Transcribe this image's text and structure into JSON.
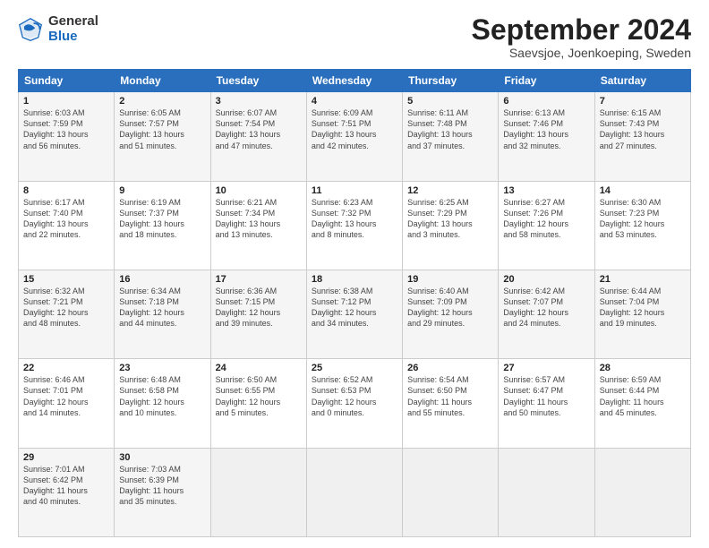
{
  "header": {
    "logo_general": "General",
    "logo_blue": "Blue",
    "month_title": "September 2024",
    "location": "Saevsjoe, Joenkoeping, Sweden"
  },
  "columns": [
    "Sunday",
    "Monday",
    "Tuesday",
    "Wednesday",
    "Thursday",
    "Friday",
    "Saturday"
  ],
  "weeks": [
    [
      {
        "day": "1",
        "info": "Sunrise: 6:03 AM\nSunset: 7:59 PM\nDaylight: 13 hours\nand 56 minutes."
      },
      {
        "day": "2",
        "info": "Sunrise: 6:05 AM\nSunset: 7:57 PM\nDaylight: 13 hours\nand 51 minutes."
      },
      {
        "day": "3",
        "info": "Sunrise: 6:07 AM\nSunset: 7:54 PM\nDaylight: 13 hours\nand 47 minutes."
      },
      {
        "day": "4",
        "info": "Sunrise: 6:09 AM\nSunset: 7:51 PM\nDaylight: 13 hours\nand 42 minutes."
      },
      {
        "day": "5",
        "info": "Sunrise: 6:11 AM\nSunset: 7:48 PM\nDaylight: 13 hours\nand 37 minutes."
      },
      {
        "day": "6",
        "info": "Sunrise: 6:13 AM\nSunset: 7:46 PM\nDaylight: 13 hours\nand 32 minutes."
      },
      {
        "day": "7",
        "info": "Sunrise: 6:15 AM\nSunset: 7:43 PM\nDaylight: 13 hours\nand 27 minutes."
      }
    ],
    [
      {
        "day": "8",
        "info": "Sunrise: 6:17 AM\nSunset: 7:40 PM\nDaylight: 13 hours\nand 22 minutes."
      },
      {
        "day": "9",
        "info": "Sunrise: 6:19 AM\nSunset: 7:37 PM\nDaylight: 13 hours\nand 18 minutes."
      },
      {
        "day": "10",
        "info": "Sunrise: 6:21 AM\nSunset: 7:34 PM\nDaylight: 13 hours\nand 13 minutes."
      },
      {
        "day": "11",
        "info": "Sunrise: 6:23 AM\nSunset: 7:32 PM\nDaylight: 13 hours\nand 8 minutes."
      },
      {
        "day": "12",
        "info": "Sunrise: 6:25 AM\nSunset: 7:29 PM\nDaylight: 13 hours\nand 3 minutes."
      },
      {
        "day": "13",
        "info": "Sunrise: 6:27 AM\nSunset: 7:26 PM\nDaylight: 12 hours\nand 58 minutes."
      },
      {
        "day": "14",
        "info": "Sunrise: 6:30 AM\nSunset: 7:23 PM\nDaylight: 12 hours\nand 53 minutes."
      }
    ],
    [
      {
        "day": "15",
        "info": "Sunrise: 6:32 AM\nSunset: 7:21 PM\nDaylight: 12 hours\nand 48 minutes."
      },
      {
        "day": "16",
        "info": "Sunrise: 6:34 AM\nSunset: 7:18 PM\nDaylight: 12 hours\nand 44 minutes."
      },
      {
        "day": "17",
        "info": "Sunrise: 6:36 AM\nSunset: 7:15 PM\nDaylight: 12 hours\nand 39 minutes."
      },
      {
        "day": "18",
        "info": "Sunrise: 6:38 AM\nSunset: 7:12 PM\nDaylight: 12 hours\nand 34 minutes."
      },
      {
        "day": "19",
        "info": "Sunrise: 6:40 AM\nSunset: 7:09 PM\nDaylight: 12 hours\nand 29 minutes."
      },
      {
        "day": "20",
        "info": "Sunrise: 6:42 AM\nSunset: 7:07 PM\nDaylight: 12 hours\nand 24 minutes."
      },
      {
        "day": "21",
        "info": "Sunrise: 6:44 AM\nSunset: 7:04 PM\nDaylight: 12 hours\nand 19 minutes."
      }
    ],
    [
      {
        "day": "22",
        "info": "Sunrise: 6:46 AM\nSunset: 7:01 PM\nDaylight: 12 hours\nand 14 minutes."
      },
      {
        "day": "23",
        "info": "Sunrise: 6:48 AM\nSunset: 6:58 PM\nDaylight: 12 hours\nand 10 minutes."
      },
      {
        "day": "24",
        "info": "Sunrise: 6:50 AM\nSunset: 6:55 PM\nDaylight: 12 hours\nand 5 minutes."
      },
      {
        "day": "25",
        "info": "Sunrise: 6:52 AM\nSunset: 6:53 PM\nDaylight: 12 hours\nand 0 minutes."
      },
      {
        "day": "26",
        "info": "Sunrise: 6:54 AM\nSunset: 6:50 PM\nDaylight: 11 hours\nand 55 minutes."
      },
      {
        "day": "27",
        "info": "Sunrise: 6:57 AM\nSunset: 6:47 PM\nDaylight: 11 hours\nand 50 minutes."
      },
      {
        "day": "28",
        "info": "Sunrise: 6:59 AM\nSunset: 6:44 PM\nDaylight: 11 hours\nand 45 minutes."
      }
    ],
    [
      {
        "day": "29",
        "info": "Sunrise: 7:01 AM\nSunset: 6:42 PM\nDaylight: 11 hours\nand 40 minutes."
      },
      {
        "day": "30",
        "info": "Sunrise: 7:03 AM\nSunset: 6:39 PM\nDaylight: 11 hours\nand 35 minutes."
      },
      {
        "day": "",
        "info": ""
      },
      {
        "day": "",
        "info": ""
      },
      {
        "day": "",
        "info": ""
      },
      {
        "day": "",
        "info": ""
      },
      {
        "day": "",
        "info": ""
      }
    ]
  ]
}
